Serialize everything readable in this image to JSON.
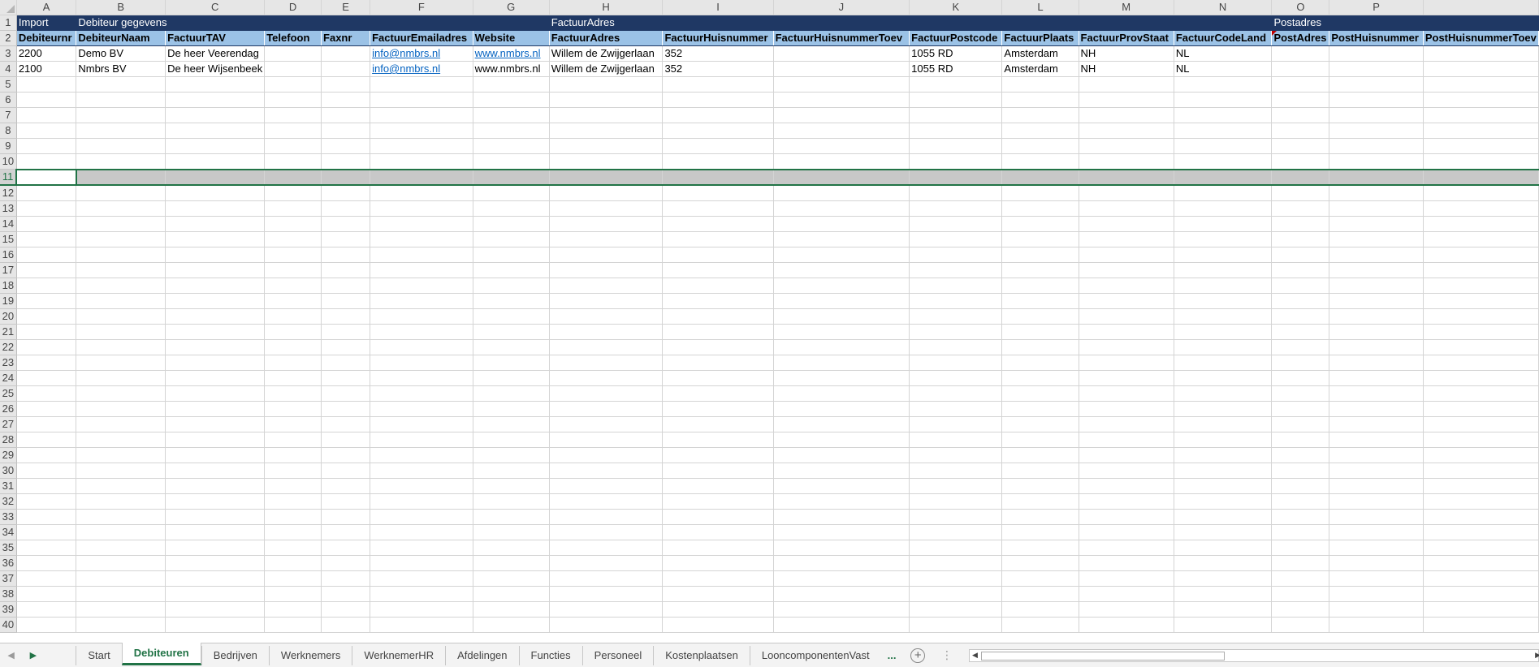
{
  "columns": [
    "A",
    "B",
    "C",
    "D",
    "E",
    "F",
    "G",
    "H",
    "I",
    "J",
    "K",
    "L",
    "M",
    "N",
    "O",
    "P"
  ],
  "group_headers": {
    "import": "Import",
    "debiteur": "Debiteur gegevens",
    "factuur_adres": "FactuurAdres",
    "postadres": "Postadres"
  },
  "field_headers": [
    "Debiteurnr",
    "DebiteurNaam",
    "FactuurTAV",
    "Telefoon",
    "Faxnr",
    "FactuurEmailadres",
    "Website",
    "FactuurAdres",
    "FactuurHuisnummer",
    "FactuurHuisnummerToev",
    "FactuurPostcode",
    "FactuurPlaats",
    "FactuurProvStaat",
    "FactuurCodeLand",
    "PostAdres",
    "PostHuisnummer",
    "PostHuisnummerToev"
  ],
  "rows": [
    [
      "2200",
      "Demo BV",
      "De heer Veerendag",
      "",
      "",
      "info@nmbrs.nl",
      "www.nmbrs.nl",
      "Willem de Zwijgerlaan",
      "352",
      "",
      "1055 RD",
      "Amsterdam",
      "NH",
      "NL",
      "",
      "",
      ""
    ],
    [
      "2100",
      "Nmbrs BV",
      "De heer Wijsenbeek",
      "",
      "",
      "info@nmbrs.nl",
      "www.nmbrs.nl",
      "Willem de Zwijgerlaan",
      "352",
      "",
      "1055 RD",
      "Amsterdam",
      "NH",
      "NL",
      "",
      "",
      ""
    ]
  ],
  "row_numbers": [
    "1",
    "2",
    "3",
    "4",
    "5",
    "6",
    "7",
    "8",
    "9",
    "10",
    "11",
    "12",
    "13",
    "14",
    "15",
    "16",
    "17",
    "18",
    "19",
    "20",
    "21",
    "22",
    "23",
    "24",
    "25",
    "26",
    "27",
    "28",
    "29",
    "30",
    "31",
    "32",
    "33",
    "34",
    "35",
    "36",
    "37",
    "38",
    "39",
    "40"
  ],
  "selected_row": "11",
  "tabs": [
    "Start",
    "Debiteuren",
    "Bedrijven",
    "Werknemers",
    "WerknemerHR",
    "Afdelingen",
    "Functies",
    "Personeel",
    "Kostenplaatsen",
    "LooncomponentenVast"
  ],
  "active_tab": "Debiteuren",
  "more_tabs_label": "...",
  "add_sheet_label": "+",
  "colors": {
    "header_dark": "#1f3864",
    "header_light": "#9bc2e6",
    "accent": "#217346",
    "link": "#0563c1",
    "selection": "#c8c8c8"
  }
}
